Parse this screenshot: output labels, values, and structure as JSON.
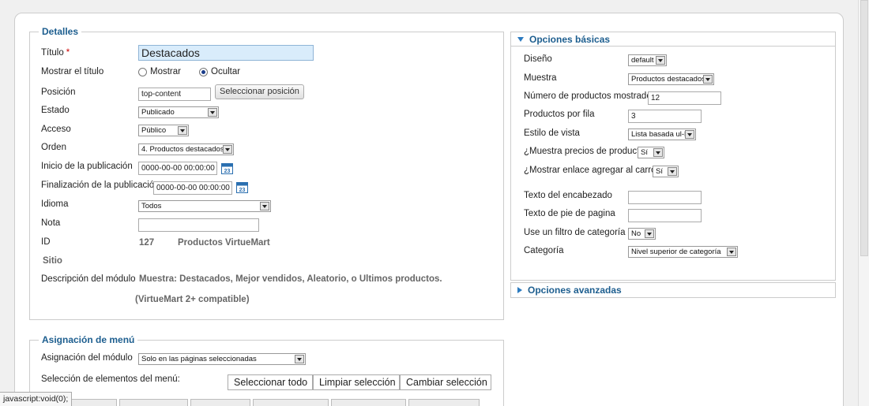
{
  "details": {
    "legend": "Detalles",
    "titulo_label": "Título",
    "titulo_required": "*",
    "titulo_value": "Destacados",
    "mostrar_titulo_label": "Mostrar el título",
    "radio_mostrar": "Mostrar",
    "radio_ocultar": "Ocultar",
    "posicion_label": "Posición",
    "posicion_value": "top-content",
    "seleccionar_posicion": "Seleccionar posición",
    "estado_label": "Estado",
    "estado_value": "Publicado",
    "acceso_label": "Acceso",
    "acceso_value": "Público",
    "orden_label": "Orden",
    "orden_value": "4. Productos destacados",
    "inicio_label": "Inicio de la publicación",
    "inicio_value": "0000-00-00 00:00:00",
    "fin_label": "Finalización de la publicación",
    "fin_value": "0000-00-00 00:00:00",
    "idioma_label": "Idioma",
    "idioma_value": "Todos",
    "nota_label": "Nota",
    "nota_value": "",
    "id_label": "ID",
    "id_value": "127",
    "id_name": "Productos VirtueMart",
    "sitio": "Sitio",
    "descripcion_label": "Descripción del módulo",
    "descripcion_value": "Muestra: Destacados, Mejor vendidos, Aleatorio, o Ultimos productos.",
    "compat": "(VirtueMart 2+ compatible)",
    "calendar_day": "23"
  },
  "menu": {
    "legend": "Asignación de menú",
    "asignacion_label": "Asignación del módulo",
    "asignacion_value": "Solo en las páginas seleccionadas",
    "seleccion_label": "Selección de elementos del menú:",
    "btn_todo": "Seleccionar todo",
    "btn_limpiar": "Limpiar selección",
    "btn_cambiar": "Cambiar selección"
  },
  "basic": {
    "header": "Opciones básicas",
    "diseno_label": "Diseño",
    "diseno_value": "default",
    "muestra_label": "Muestra",
    "muestra_value": "Productos destacados",
    "num_label": "Número de productos mostrados",
    "num_value": "12",
    "porfila_label": "Productos por fila",
    "porfila_value": "3",
    "estilo_label": "Estilo de vista",
    "estilo_value": "Lista basada ul-li",
    "precios_label": "¿Muestra precios de producto",
    "precios_value": "Sí",
    "carro_label": "¿Mostrar enlace agregar al carro?",
    "carro_value": "Sí",
    "encabezado_label": "Texto del encabezado",
    "pie_label": "Texto de pie de pagina",
    "filtro_label": "Use un filtro de categoría",
    "filtro_value": "No",
    "categoria_label": "Categoría",
    "categoria_value": "Nivel superior de categoría"
  },
  "advanced": {
    "header": "Opciones avanzadas"
  },
  "status": "javascript:void(0);",
  "colors": {
    "accent": "#1d5e8f",
    "title_bg": "#d9ecfb"
  }
}
